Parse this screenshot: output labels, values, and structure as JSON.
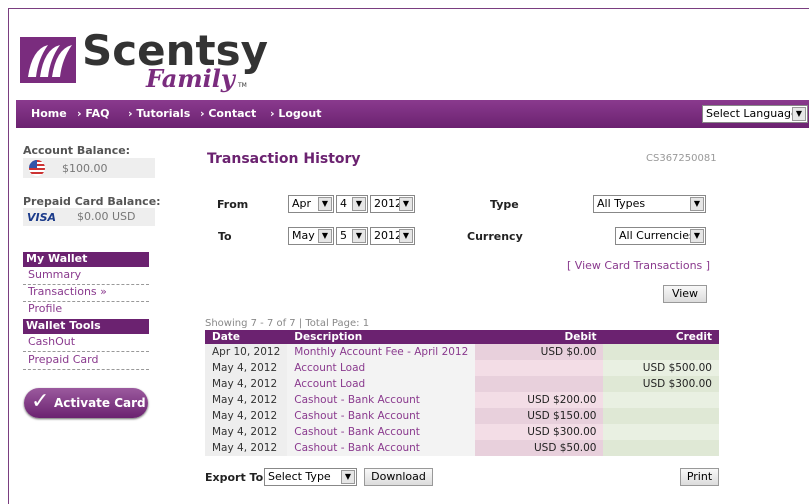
{
  "brand": {
    "word": "Scentsy",
    "sub": "Family",
    "tm": "TM"
  },
  "nav": {
    "items": [
      "Home",
      "› FAQ",
      "› Tutorials",
      "› Contact",
      "› Logout"
    ],
    "language": "Select Language"
  },
  "sidebar": {
    "account_balance_label": "Account Balance:",
    "account_balance": "$100.00",
    "prepaid_label": "Prepaid Card Balance:",
    "prepaid_brand": "VISA",
    "prepaid_balance": "$0.00 USD",
    "wallet_head": "My Wallet",
    "wallet_items": [
      "Summary",
      "Transactions »",
      "Profile"
    ],
    "tools_head": "Wallet Tools",
    "tools_items": [
      "CashOut",
      "Prepaid Card"
    ],
    "activate": "Activate Card"
  },
  "main": {
    "title": "Transaction History",
    "account_id": "CS367250081",
    "from_label": "From",
    "to_label": "To",
    "from": {
      "month": "Apr",
      "day": "4",
      "year": "2012"
    },
    "to": {
      "month": "May",
      "day": "5",
      "year": "2012"
    },
    "type_label": "Type",
    "type_value": "All Types",
    "currency_label": "Currency",
    "currency_value": "All Currencies",
    "view_card_link": "[ View Card Transactions ]",
    "view_button": "View",
    "showing": "Showing 7 - 7 of 7 | Total Page: 1",
    "columns": [
      "Date",
      "Description",
      "Debit",
      "Credit"
    ],
    "rows": [
      {
        "date": "Apr 10, 2012",
        "desc": "Monthly Account Fee - April 2012",
        "debit": "USD $0.00",
        "credit": ""
      },
      {
        "date": "May 4, 2012",
        "desc": "Account Load",
        "debit": "",
        "credit": "USD $500.00"
      },
      {
        "date": "May 4, 2012",
        "desc": "Account Load",
        "debit": "",
        "credit": "USD $300.00"
      },
      {
        "date": "May 4, 2012",
        "desc": "Cashout - Bank Account",
        "debit": "USD $200.00",
        "credit": ""
      },
      {
        "date": "May 4, 2012",
        "desc": "Cashout - Bank Account",
        "debit": "USD $150.00",
        "credit": ""
      },
      {
        "date": "May 4, 2012",
        "desc": "Cashout - Bank Account",
        "debit": "USD $300.00",
        "credit": ""
      },
      {
        "date": "May 4, 2012",
        "desc": "Cashout - Bank Account",
        "debit": "USD $50.00",
        "credit": ""
      }
    ],
    "export_label": "Export To",
    "export_value": "Select Type",
    "download_button": "Download",
    "print_button": "Print"
  },
  "colors": {
    "brand_purple": "#6b2270",
    "link_purple": "#8a3a8e",
    "debit_bg": "#e8d0dc",
    "credit_bg": "#dfe8d5"
  }
}
